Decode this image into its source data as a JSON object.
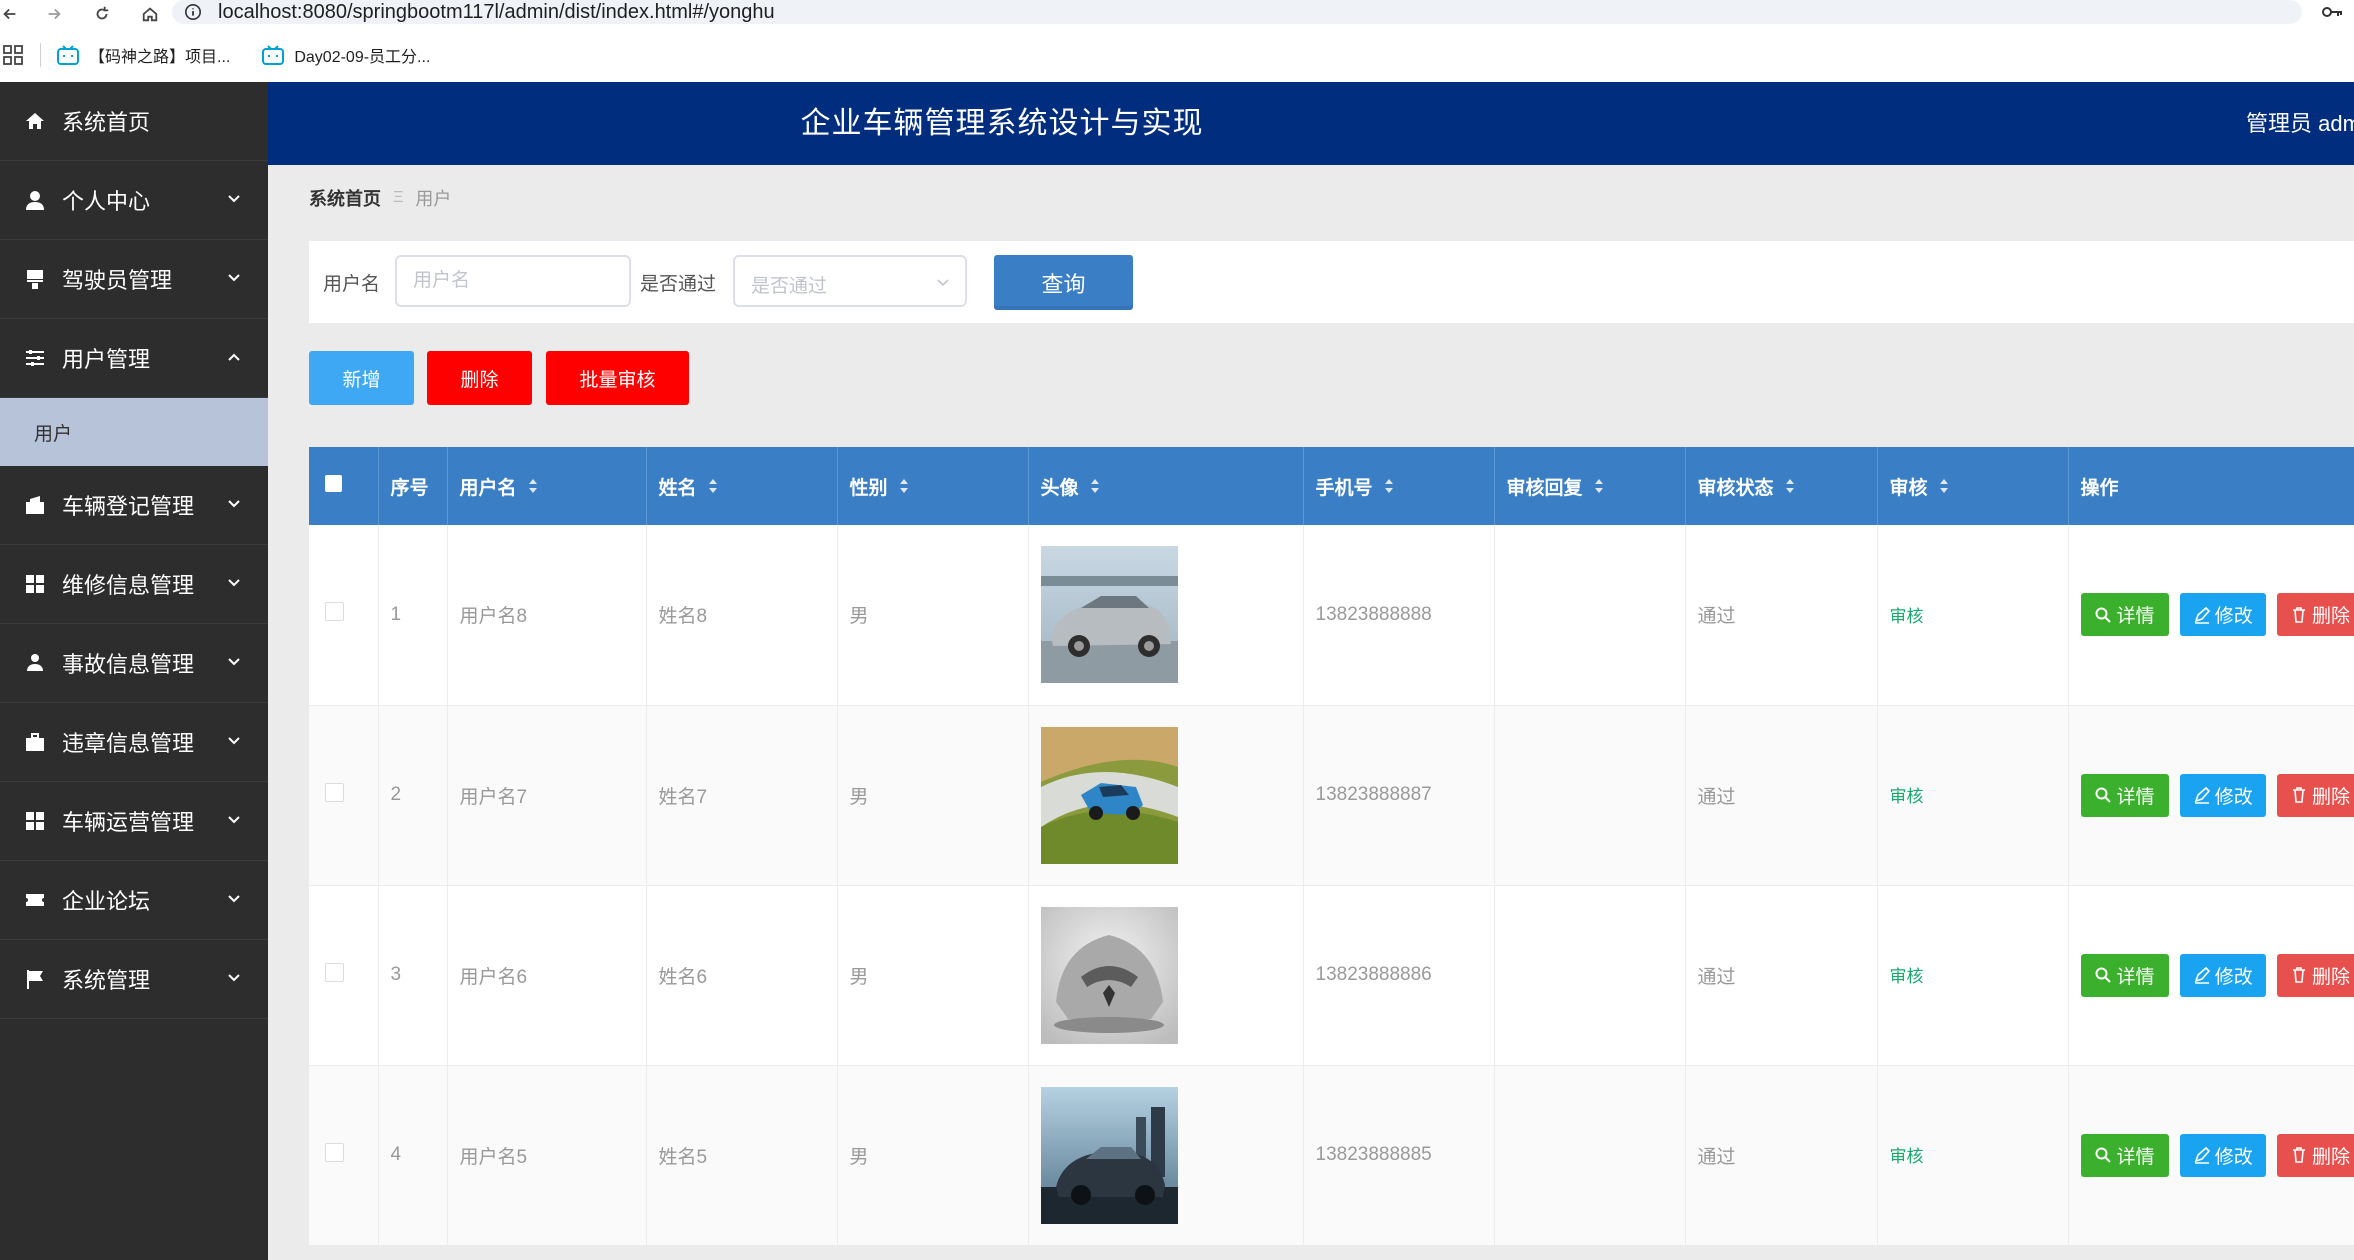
{
  "browser": {
    "url": "localhost:8080/springbootm117l/admin/dist/index.html#/yonghu",
    "bookmarks": [
      "【码神之路】项目...",
      "Day02-09-员工分..."
    ]
  },
  "header": {
    "title": "企业车辆管理系统设计与实现",
    "user": "管理员 admin"
  },
  "sidebar": {
    "items": [
      {
        "label": "系统首页",
        "icon": "home-icon"
      },
      {
        "label": "个人中心",
        "icon": "user-icon"
      },
      {
        "label": "驾驶员管理",
        "icon": "brush-icon"
      },
      {
        "label": "用户管理",
        "icon": "sliders-icon"
      },
      {
        "label": "车辆登记管理",
        "icon": "briefcase-icon"
      },
      {
        "label": "维修信息管理",
        "icon": "grid-icon"
      },
      {
        "label": "事故信息管理",
        "icon": "person-icon"
      },
      {
        "label": "违章信息管理",
        "icon": "suitcase-icon"
      },
      {
        "label": "车辆运营管理",
        "icon": "grid-icon"
      },
      {
        "label": "企业论坛",
        "icon": "ticket-icon"
      },
      {
        "label": "系统管理",
        "icon": "flag-icon"
      }
    ],
    "submenu": {
      "label": "用户"
    }
  },
  "breadcrumb": {
    "home": "系统首页",
    "separator": "Ξ",
    "current": "用户"
  },
  "search": {
    "username_label": "用户名",
    "username_placeholder": "用户名",
    "passed_label": "是否通过",
    "passed_placeholder": "是否通过",
    "query_label": "查询"
  },
  "actions": {
    "add": "新增",
    "delete": "删除",
    "batch_audit": "批量审核"
  },
  "table": {
    "columns": [
      "序号",
      "用户名",
      "姓名",
      "性别",
      "头像",
      "手机号",
      "审核回复",
      "审核状态",
      "审核",
      "操作"
    ],
    "rows": [
      {
        "index": "1",
        "username": "用户名8",
        "name": "姓名8",
        "gender": "男",
        "phone": "13823888888",
        "reply": "",
        "status": "通过",
        "audit": "审核"
      },
      {
        "index": "2",
        "username": "用户名7",
        "name": "姓名7",
        "gender": "男",
        "phone": "13823888887",
        "reply": "",
        "status": "通过",
        "audit": "审核"
      },
      {
        "index": "3",
        "username": "用户名6",
        "name": "姓名6",
        "gender": "男",
        "phone": "13823888886",
        "reply": "",
        "status": "通过",
        "audit": "审核"
      },
      {
        "index": "4",
        "username": "用户名5",
        "name": "姓名5",
        "gender": "男",
        "phone": "13823888885",
        "reply": "",
        "status": "通过",
        "audit": "审核"
      }
    ],
    "ops": {
      "detail": "详情",
      "edit": "修改",
      "delete": "删除"
    }
  },
  "colors": {
    "sidebar_bg": "#2d2d2d",
    "header_bg": "#002d7e",
    "table_header_bg": "#3a7ec6",
    "add_button": "#3fa8f5",
    "delete_button": "#ff0000",
    "detail_button": "#3ab02d",
    "edit_button": "#1aa3f0",
    "op_delete_button": "#e8504e",
    "audit_link": "#1aa86f"
  }
}
